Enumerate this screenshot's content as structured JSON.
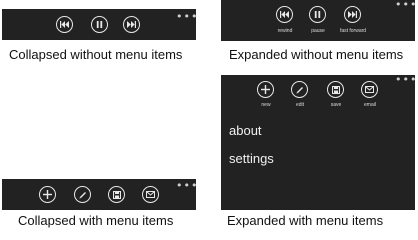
{
  "panels": {
    "collapsed_no_menu": {
      "caption": "Collapsed without menu items",
      "overflow": "•••"
    },
    "expanded_no_menu": {
      "caption": "Expanded without menu items",
      "overflow": "•••",
      "buttons": [
        {
          "icon": "rewind-icon",
          "label": "rewind"
        },
        {
          "icon": "pause-icon",
          "label": "pause"
        },
        {
          "icon": "fast-forward-icon",
          "label": "fast forward"
        }
      ]
    },
    "collapsed_with_menu": {
      "caption": "Collapsed with menu items",
      "overflow": "•••"
    },
    "expanded_with_menu": {
      "caption": "Expanded with menu items",
      "overflow": "•••",
      "buttons": [
        {
          "icon": "add-icon",
          "label": "new"
        },
        {
          "icon": "pencil-icon",
          "label": "edit"
        },
        {
          "icon": "save-icon",
          "label": "save"
        },
        {
          "icon": "email-icon",
          "label": "email"
        }
      ],
      "menu_items": [
        "about",
        "settings"
      ]
    }
  },
  "colors": {
    "bar": "#222222",
    "icon": "#e8e8e8",
    "caption": "#111111"
  }
}
